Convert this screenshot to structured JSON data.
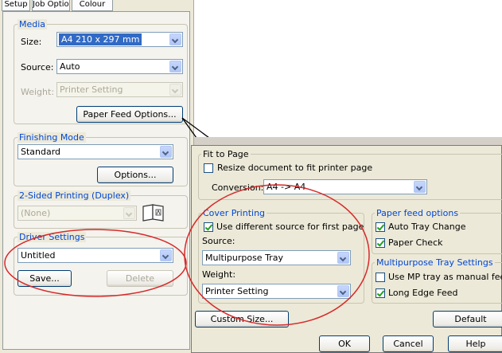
{
  "tabs": [
    "Setup",
    "Job Options",
    "Colour"
  ],
  "media": {
    "legend": "Media",
    "size_label": "Size:",
    "size_value": "A4 210 x 297 mm",
    "source_label": "Source:",
    "source_value": "Auto",
    "weight_label": "Weight:",
    "weight_value": "Printer Setting",
    "paper_feed_button": "Paper Feed Options..."
  },
  "finishing": {
    "legend": "Finishing Mode",
    "value": "Standard",
    "options_button": "Options..."
  },
  "duplex": {
    "legend": "2-Sided Printing (Duplex)",
    "value": "(None)"
  },
  "driver": {
    "legend": "Driver Settings",
    "value": "Untitled",
    "save_button": "Save...",
    "delete_button": "Delete"
  },
  "popup": {
    "fit": {
      "legend": "Fit to Page",
      "resize_label": "Resize document to fit printer page",
      "resize_checked": false,
      "conversion_label": "Conversion:",
      "conversion_value": "A4 -> A4"
    },
    "cover": {
      "legend": "Cover Printing",
      "use_diff_label": "Use different source for first page",
      "use_diff_checked": true,
      "source_label": "Source:",
      "source_value": "Multipurpose Tray",
      "weight_label": "Weight:",
      "weight_value": "Printer Setting"
    },
    "feed": {
      "legend": "Paper feed options",
      "auto_tray_label": "Auto Tray Change",
      "auto_tray_checked": true,
      "paper_check_label": "Paper Check",
      "paper_check_checked": true
    },
    "mp": {
      "legend": "Multipurpose Tray Settings",
      "manual_label": "Use MP tray as manual feed",
      "manual_checked": false,
      "long_edge_label": "Long Edge Feed",
      "long_edge_checked": true
    },
    "custom_size_button": "Custom Size...",
    "default_button": "Default",
    "ok_button": "OK",
    "cancel_button": "Cancel",
    "help_button": "Help"
  },
  "colors": {
    "panel": "#ece9d8",
    "legend_text": "#0046d5",
    "highlight_circle": "#d62a2a"
  }
}
